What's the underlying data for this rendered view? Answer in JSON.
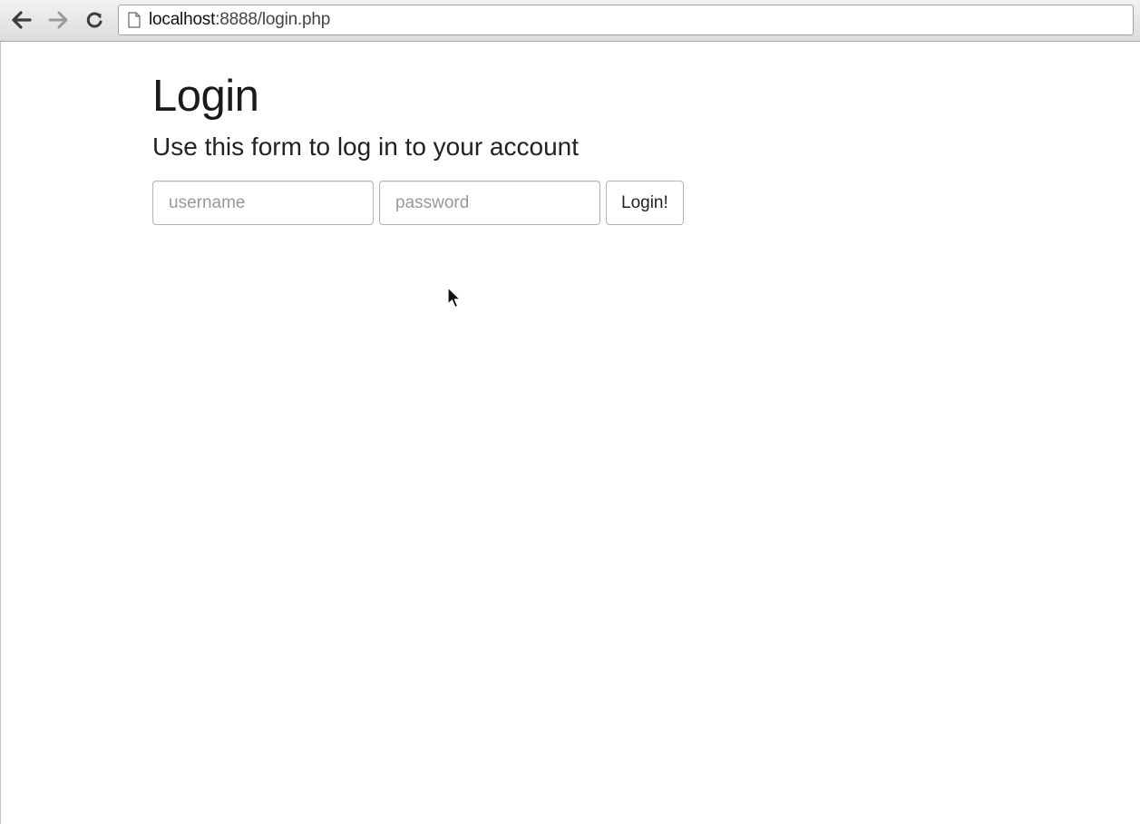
{
  "browser": {
    "url_host": "localhost",
    "url_rest": ":8888/login.php",
    "icons": {
      "back": "back-arrow-icon",
      "forward": "forward-arrow-icon",
      "reload": "reload-icon",
      "page": "page-icon"
    }
  },
  "page": {
    "title": "Login",
    "subtitle": "Use this form to log in to your account"
  },
  "form": {
    "username_placeholder": "username",
    "username_value": "",
    "password_placeholder": "password",
    "password_value": "",
    "submit_label": "Login!"
  },
  "colors": {
    "toolbar_bg": "#dcdcdc",
    "page_bg": "#ffffff",
    "text": "#1a1a1a",
    "input_border": "#b5b5b5",
    "placeholder": "#999999"
  }
}
